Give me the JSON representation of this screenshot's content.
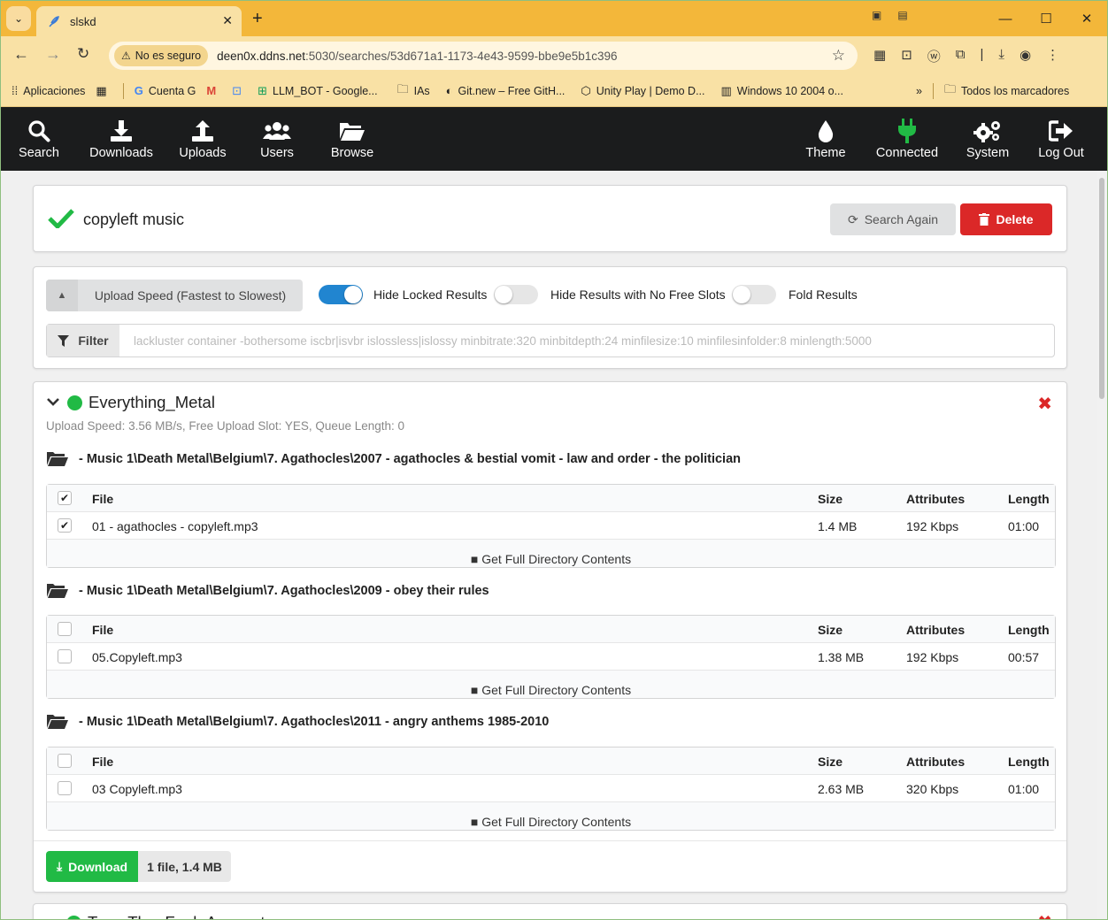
{
  "browser": {
    "tab_title": "slskd",
    "security_label": "No es seguro",
    "url_host": "deen0x.ddns.net",
    "url_rest": ":5030/searches/53d671a1-1173-4e43-9599-bbe9e5b1c396",
    "bookmarks": [
      {
        "label": "Aplicaciones",
        "icon": "apps-icon"
      },
      {
        "label": "Cuenta G",
        "icon": "google-icon"
      },
      {
        "label": "LLM_BOT - Google...",
        "icon": "sheets-icon"
      },
      {
        "label": "IAs",
        "icon": "folder-icon"
      },
      {
        "label": "Git.new – Free GitH...",
        "icon": "gitnew-icon"
      },
      {
        "label": "Unity Play | Demo D...",
        "icon": "unity-icon"
      },
      {
        "label": "Windows 10 2004 o...",
        "icon": "archive-icon"
      }
    ],
    "all_bookmarks": "Todos los marcadores"
  },
  "nav": {
    "search": "Search",
    "downloads": "Downloads",
    "uploads": "Uploads",
    "users": "Users",
    "browse": "Browse",
    "theme": "Theme",
    "connected": "Connected",
    "system": "System",
    "logout": "Log Out"
  },
  "search": {
    "query": "copyleft music",
    "again_label": "Search Again",
    "delete_label": "Delete"
  },
  "filters": {
    "sort": "Upload Speed (Fastest to Slowest)",
    "hide_locked": "Hide Locked Results",
    "hide_no_slots": "Hide Results with No Free Slots",
    "fold_results": "Fold Results",
    "filter_label": "Filter",
    "filter_placeholder": "lackluster container -bothersome iscbr|isvbr islossless|islossy  minbitrate:320 minbitdepth:24 minfilesize:10 minfilesinfolder:8 minlength:5000"
  },
  "result": {
    "username": "Everything_Metal",
    "stats": "Upload Speed: 3.56 MB/s, Free Upload Slot: YES, Queue Length: 0",
    "columns": {
      "file": "File",
      "size": "Size",
      "attributes": "Attributes",
      "length": "Length"
    },
    "get_full": "Get Full Directory Contents",
    "directories": [
      {
        "path": "- Music 1\\Death Metal\\Belgium\\7. Agathocles\\2007 - agathocles & bestial vomit - law and order - the politician",
        "files": [
          {
            "name": "01 - agathocles - copyleft.mp3",
            "size": "1.4 MB",
            "attributes": "192 Kbps",
            "length": "01:00"
          }
        ]
      },
      {
        "path": "- Music 1\\Death Metal\\Belgium\\7. Agathocles\\2009 - obey their rules",
        "files": [
          {
            "name": "05.Copyleft.mp3",
            "size": "1.38 MB",
            "attributes": "192 Kbps",
            "length": "00:57"
          }
        ]
      },
      {
        "path": "- Music 1\\Death Metal\\Belgium\\7. Agathocles\\2011 - angry anthems 1985-2010",
        "files": [
          {
            "name": "03 Copyleft.mp3",
            "size": "2.63 MB",
            "attributes": "320 Kbps",
            "length": "01:00"
          }
        ]
      }
    ],
    "download_label": "Download",
    "download_count": "1 file, 1.4 MB"
  },
  "next_result": {
    "username": "Tom_The_Fool_Account"
  }
}
